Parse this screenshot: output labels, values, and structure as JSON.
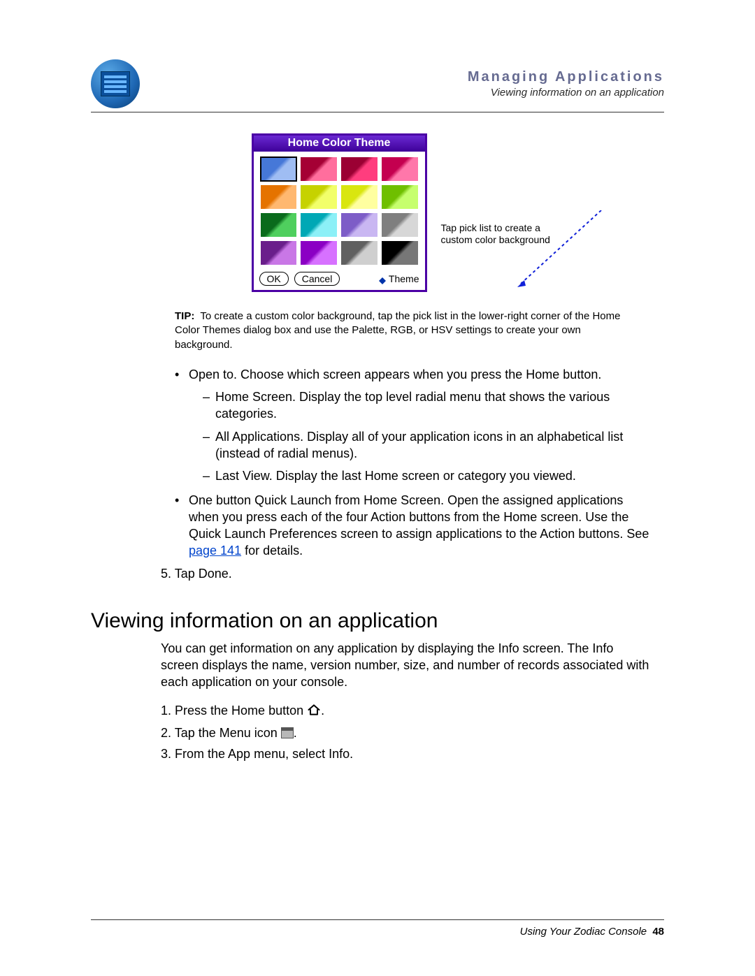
{
  "header": {
    "title": "Managing Applications",
    "subtitle": "Viewing information on an application"
  },
  "color_dialog": {
    "title": "Home Color Theme",
    "ok": "OK",
    "cancel": "Cancel",
    "theme_label": "Theme",
    "swatches": [
      {
        "c1": "#4678d8",
        "c2": "#9fbdf3",
        "selected": true
      },
      {
        "c1": "#a50034",
        "c2": "#ff6e9d",
        "selected": false
      },
      {
        "c1": "#9b0033",
        "c2": "#ff3d7e",
        "selected": false
      },
      {
        "c1": "#c4004f",
        "c2": "#ff77aa",
        "selected": false
      },
      {
        "c1": "#e57300",
        "c2": "#ffb870",
        "selected": false
      },
      {
        "c1": "#c6d200",
        "c2": "#f2ff6a",
        "selected": false
      },
      {
        "c1": "#d9e60f",
        "c2": "#ffffa0",
        "selected": false
      },
      {
        "c1": "#6fbf00",
        "c2": "#c6ff6e",
        "selected": false
      },
      {
        "c1": "#0a6b1c",
        "c2": "#4fcf5e",
        "selected": false
      },
      {
        "c1": "#00a8b5",
        "c2": "#8cf0f7",
        "selected": false
      },
      {
        "c1": "#7d5dc7",
        "c2": "#c9b7f2",
        "selected": false
      },
      {
        "c1": "#7f7f7f",
        "c2": "#d7d7d7",
        "selected": false
      },
      {
        "c1": "#6a1e8b",
        "c2": "#c977e6",
        "selected": false
      },
      {
        "c1": "#8b00c4",
        "c2": "#d771ff",
        "selected": false
      },
      {
        "c1": "#606060",
        "c2": "#cfcfcf",
        "selected": false
      },
      {
        "c1": "#000000",
        "c2": "#777777",
        "selected": false
      }
    ]
  },
  "annotation": "Tap pick list to create a custom color background",
  "tip": {
    "label": "TIP:",
    "text": "To create a custom color background, tap the pick list in the lower-right corner of the Home Color Themes dialog box and use the Palette, RGB, or HSV settings to create your own background."
  },
  "bullets": {
    "open_to": "Open to. Choose which screen appears when you press the Home button.",
    "home_screen": "Home Screen. Display the top level radial menu that shows the various categories.",
    "all_apps": "All Applications. Display all of your application icons in an alphabetical list (instead of radial menus).",
    "last_view": "Last View. Display the last Home screen or category you viewed.",
    "quick_launch_pre": "One button Quick Launch from Home Screen. Open the assigned applications when you press each of the four Action buttons from the Home screen. Use the Quick Launch Preferences screen to assign applications to the Action buttons. See ",
    "quick_launch_link": "page 141",
    "quick_launch_post": " for details."
  },
  "step5": "5. Tap Done.",
  "section": {
    "heading": "Viewing information on an application",
    "intro": "You can get information on any application by displaying the Info screen. The Info screen displays the name, version number, size, and number of records associated with each application on your console.",
    "s1_pre": "1. Press the Home button ",
    "s1_post": ".",
    "s2_pre": "2. Tap the Menu icon ",
    "s2_post": ".",
    "s3": "3. From the App menu, select Info."
  },
  "footer": {
    "text": "Using Your Zodiac Console",
    "page": "48"
  }
}
